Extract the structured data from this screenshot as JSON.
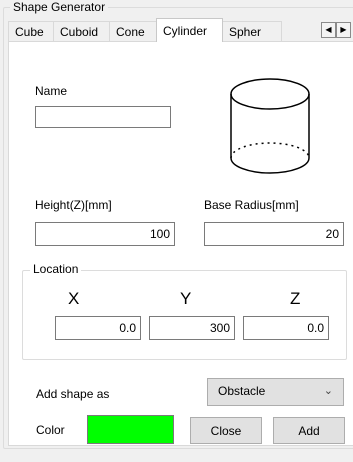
{
  "group": {
    "title": "Shape Generator"
  },
  "tabs": [
    {
      "label": "Cube"
    },
    {
      "label": "Cuboid"
    },
    {
      "label": "Cone"
    },
    {
      "label": "Cylinder"
    },
    {
      "label": "Spher"
    }
  ],
  "tab_scroll": {
    "left_icon": "◀",
    "right_icon": "▶"
  },
  "name": {
    "label": "Name",
    "value": ""
  },
  "preview": {
    "icon": "cylinder-icon"
  },
  "height": {
    "label": "Height(Z)[mm]",
    "value": "100"
  },
  "radius": {
    "label": "Base Radius[mm]",
    "value": "20"
  },
  "location": {
    "title": "Location",
    "x_label": "X",
    "y_label": "Y",
    "z_label": "Z",
    "x": "0.0",
    "y": "300",
    "z": "0.0"
  },
  "add_shape": {
    "label": "Add shape as",
    "selected": "Obstacle"
  },
  "color": {
    "label": "Color",
    "value": "#00ff00"
  },
  "buttons": {
    "close": "Close",
    "add": "Add"
  }
}
